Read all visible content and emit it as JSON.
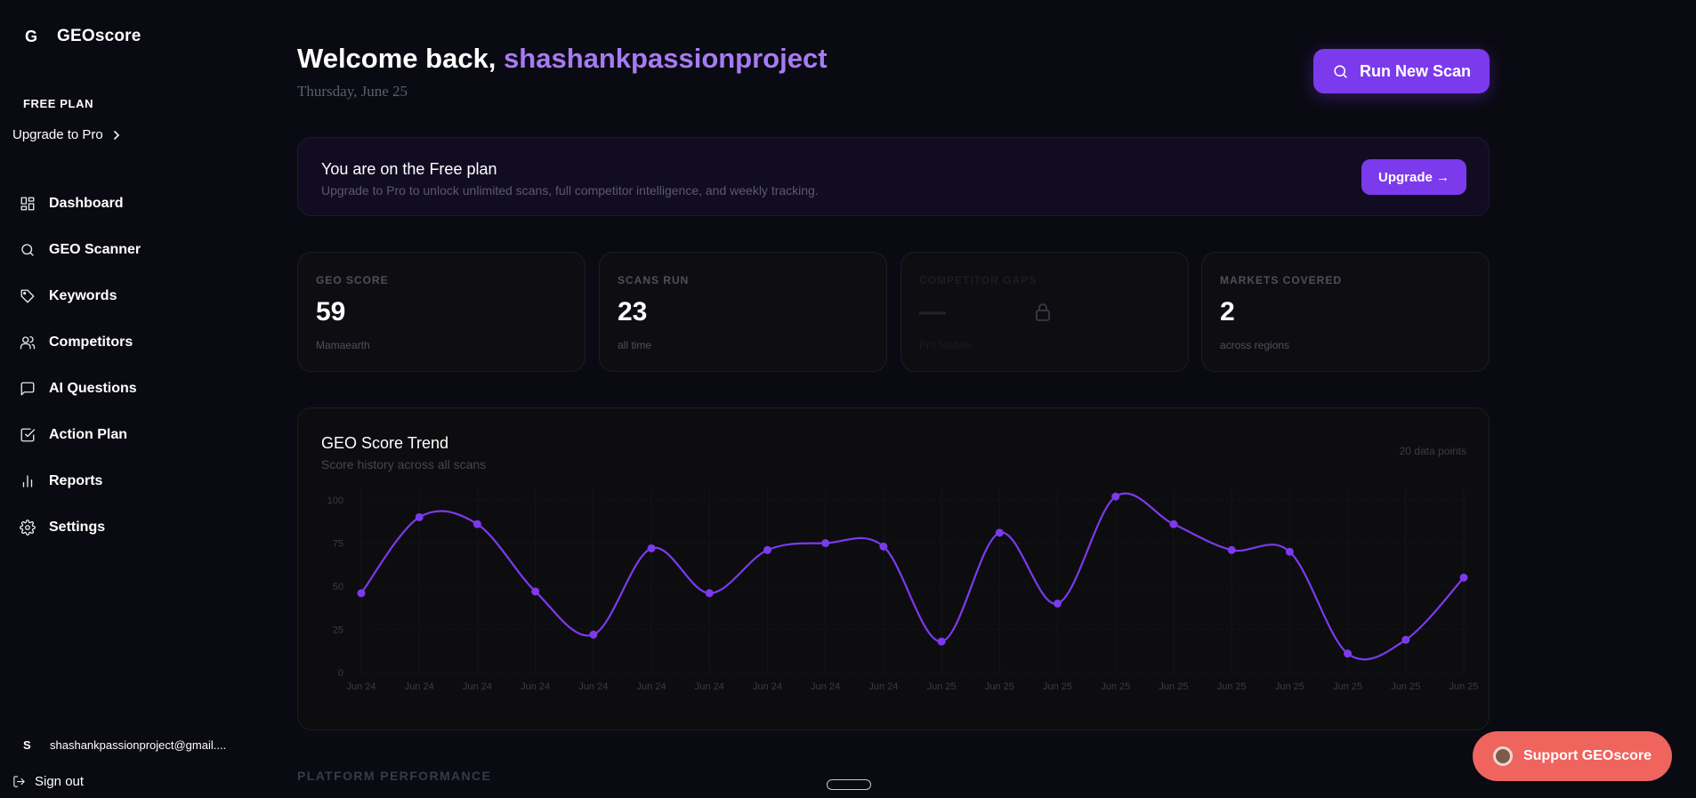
{
  "sidebar": {
    "logo_mark": "G",
    "logo_text": "GEOscore",
    "plan_label": "FREE PLAN",
    "upgrade_link": "Upgrade to Pro",
    "items": [
      {
        "label": "Dashboard",
        "icon": "grid-icon"
      },
      {
        "label": "GEO Scanner",
        "icon": "search-icon"
      },
      {
        "label": "Keywords",
        "icon": "tag-icon"
      },
      {
        "label": "Competitors",
        "icon": "users-icon"
      },
      {
        "label": "AI Questions",
        "icon": "message-icon"
      },
      {
        "label": "Action Plan",
        "icon": "checkbox-icon"
      },
      {
        "label": "Reports",
        "icon": "bar-chart-icon"
      },
      {
        "label": "Settings",
        "icon": "gear-icon"
      }
    ],
    "user_initial": "S",
    "user_email": "shashankpassionproject@gmail....",
    "signout": "Sign out"
  },
  "header": {
    "welcome_prefix": "Welcome back, ",
    "username": "shashankpassionproject",
    "date": "Thursday, June 25",
    "scan_button": "Run New Scan"
  },
  "banner": {
    "title": "You are on the Free plan",
    "subtitle": "Upgrade to Pro to unlock unlimited scans, full competitor intelligence, and weekly tracking.",
    "button": "Upgrade →"
  },
  "stats": [
    {
      "label": "GEO SCORE",
      "value": "59",
      "sub": "Mamaearth"
    },
    {
      "label": "SCANS RUN",
      "value": "23",
      "sub": "all time"
    },
    {
      "label": "COMPETITOR GAPS",
      "value": "—",
      "sub": "Pro feature",
      "locked": true
    },
    {
      "label": "MARKETS COVERED",
      "value": "2",
      "sub": "across regions"
    }
  ],
  "trend": {
    "title": "GEO Score Trend",
    "subtitle": "Score history across all scans",
    "count": "20 data points"
  },
  "chart_data": {
    "type": "line",
    "x": [
      "Jun 24",
      "Jun 24",
      "Jun 24",
      "Jun 24",
      "Jun 24",
      "Jun 24",
      "Jun 24",
      "Jun 24",
      "Jun 24",
      "Jun 24",
      "Jun 25",
      "Jun 25",
      "Jun 25",
      "Jun 25",
      "Jun 25",
      "Jun 25",
      "Jun 25",
      "Jun 25",
      "Jun 25",
      "Jun 25"
    ],
    "series": [
      {
        "values": [
          46,
          90,
          86,
          47,
          22,
          72,
          46,
          71,
          75,
          73,
          18,
          81,
          40,
          102,
          86,
          71,
          70,
          11,
          19,
          55
        ]
      }
    ],
    "yticks": [
      0,
      25,
      50,
      75,
      100
    ],
    "ylim": [
      0,
      100
    ],
    "color": "#7c3aed"
  },
  "section_label": "PLATFORM PERFORMANCE",
  "support_button": "Support GEOscore",
  "colors": {
    "accent": "#7c3aed",
    "accent_text": "#a77bf3",
    "support": "#f0645e"
  }
}
